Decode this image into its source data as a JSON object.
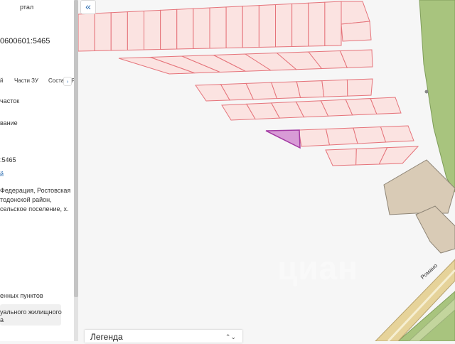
{
  "sidebar": {
    "portal_title": "ртал",
    "cadastral_number": "0600601:5465",
    "tabs": [
      {
        "label": "й"
      },
      {
        "label": "Части ЗУ"
      },
      {
        "label": "Соста"
      },
      {
        "label": "Р"
      }
    ],
    "tabs_next": "›",
    "object_type": "часток",
    "name_value": "вание",
    "number_short": ":5465",
    "link_mark": "й",
    "address_line1": "Федерация, Ростовская",
    "address_line2": "тодонской район,",
    "address_line3": "сельское поселение, х.",
    "category": "енных пунктов",
    "use_line1": "уального жилищного",
    "use_line2": "а"
  },
  "map": {
    "collapse_icon": "«",
    "watermark": "циан",
    "road_label": "Романо",
    "legend": {
      "label": "Легенда",
      "toggle_icon": "⌃⌄"
    },
    "colors": {
      "background": "#f6f6f6",
      "parcel_fill": "#fbe3e1",
      "parcel_stroke": "#e5737a",
      "selected_fill": "#d89bd6",
      "selected_stroke": "#a33aa3",
      "building_fill": "#d9cbb6",
      "building_stroke": "#8f8677",
      "green_area": "#a8c47e",
      "road": "#e6d39a"
    }
  }
}
